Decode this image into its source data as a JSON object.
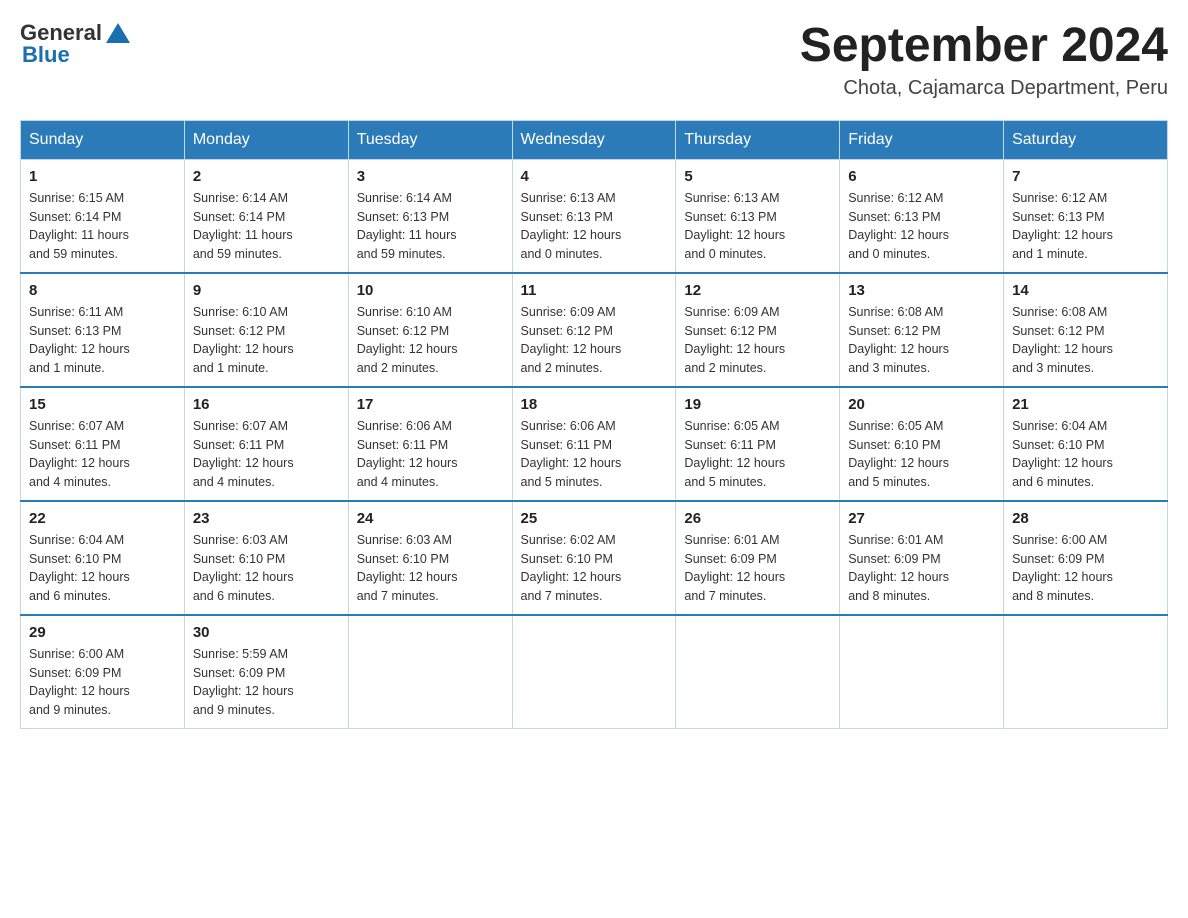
{
  "header": {
    "logo": {
      "general": "General",
      "blue": "Blue"
    },
    "title": "September 2024",
    "location": "Chota, Cajamarca Department, Peru"
  },
  "weekdays": [
    "Sunday",
    "Monday",
    "Tuesday",
    "Wednesday",
    "Thursday",
    "Friday",
    "Saturday"
  ],
  "weeks": [
    [
      {
        "day": "1",
        "sunrise": "6:15 AM",
        "sunset": "6:14 PM",
        "daylight": "11 hours and 59 minutes."
      },
      {
        "day": "2",
        "sunrise": "6:14 AM",
        "sunset": "6:14 PM",
        "daylight": "11 hours and 59 minutes."
      },
      {
        "day": "3",
        "sunrise": "6:14 AM",
        "sunset": "6:13 PM",
        "daylight": "11 hours and 59 minutes."
      },
      {
        "day": "4",
        "sunrise": "6:13 AM",
        "sunset": "6:13 PM",
        "daylight": "12 hours and 0 minutes."
      },
      {
        "day": "5",
        "sunrise": "6:13 AM",
        "sunset": "6:13 PM",
        "daylight": "12 hours and 0 minutes."
      },
      {
        "day": "6",
        "sunrise": "6:12 AM",
        "sunset": "6:13 PM",
        "daylight": "12 hours and 0 minutes."
      },
      {
        "day": "7",
        "sunrise": "6:12 AM",
        "sunset": "6:13 PM",
        "daylight": "12 hours and 1 minute."
      }
    ],
    [
      {
        "day": "8",
        "sunrise": "6:11 AM",
        "sunset": "6:13 PM",
        "daylight": "12 hours and 1 minute."
      },
      {
        "day": "9",
        "sunrise": "6:10 AM",
        "sunset": "6:12 PM",
        "daylight": "12 hours and 1 minute."
      },
      {
        "day": "10",
        "sunrise": "6:10 AM",
        "sunset": "6:12 PM",
        "daylight": "12 hours and 2 minutes."
      },
      {
        "day": "11",
        "sunrise": "6:09 AM",
        "sunset": "6:12 PM",
        "daylight": "12 hours and 2 minutes."
      },
      {
        "day": "12",
        "sunrise": "6:09 AM",
        "sunset": "6:12 PM",
        "daylight": "12 hours and 2 minutes."
      },
      {
        "day": "13",
        "sunrise": "6:08 AM",
        "sunset": "6:12 PM",
        "daylight": "12 hours and 3 minutes."
      },
      {
        "day": "14",
        "sunrise": "6:08 AM",
        "sunset": "6:12 PM",
        "daylight": "12 hours and 3 minutes."
      }
    ],
    [
      {
        "day": "15",
        "sunrise": "6:07 AM",
        "sunset": "6:11 PM",
        "daylight": "12 hours and 4 minutes."
      },
      {
        "day": "16",
        "sunrise": "6:07 AM",
        "sunset": "6:11 PM",
        "daylight": "12 hours and 4 minutes."
      },
      {
        "day": "17",
        "sunrise": "6:06 AM",
        "sunset": "6:11 PM",
        "daylight": "12 hours and 4 minutes."
      },
      {
        "day": "18",
        "sunrise": "6:06 AM",
        "sunset": "6:11 PM",
        "daylight": "12 hours and 5 minutes."
      },
      {
        "day": "19",
        "sunrise": "6:05 AM",
        "sunset": "6:11 PM",
        "daylight": "12 hours and 5 minutes."
      },
      {
        "day": "20",
        "sunrise": "6:05 AM",
        "sunset": "6:10 PM",
        "daylight": "12 hours and 5 minutes."
      },
      {
        "day": "21",
        "sunrise": "6:04 AM",
        "sunset": "6:10 PM",
        "daylight": "12 hours and 6 minutes."
      }
    ],
    [
      {
        "day": "22",
        "sunrise": "6:04 AM",
        "sunset": "6:10 PM",
        "daylight": "12 hours and 6 minutes."
      },
      {
        "day": "23",
        "sunrise": "6:03 AM",
        "sunset": "6:10 PM",
        "daylight": "12 hours and 6 minutes."
      },
      {
        "day": "24",
        "sunrise": "6:03 AM",
        "sunset": "6:10 PM",
        "daylight": "12 hours and 7 minutes."
      },
      {
        "day": "25",
        "sunrise": "6:02 AM",
        "sunset": "6:10 PM",
        "daylight": "12 hours and 7 minutes."
      },
      {
        "day": "26",
        "sunrise": "6:01 AM",
        "sunset": "6:09 PM",
        "daylight": "12 hours and 7 minutes."
      },
      {
        "day": "27",
        "sunrise": "6:01 AM",
        "sunset": "6:09 PM",
        "daylight": "12 hours and 8 minutes."
      },
      {
        "day": "28",
        "sunrise": "6:00 AM",
        "sunset": "6:09 PM",
        "daylight": "12 hours and 8 minutes."
      }
    ],
    [
      {
        "day": "29",
        "sunrise": "6:00 AM",
        "sunset": "6:09 PM",
        "daylight": "12 hours and 9 minutes."
      },
      {
        "day": "30",
        "sunrise": "5:59 AM",
        "sunset": "6:09 PM",
        "daylight": "12 hours and 9 minutes."
      },
      null,
      null,
      null,
      null,
      null
    ]
  ],
  "labels": {
    "sunrise": "Sunrise:",
    "sunset": "Sunset:",
    "daylight": "Daylight:"
  }
}
